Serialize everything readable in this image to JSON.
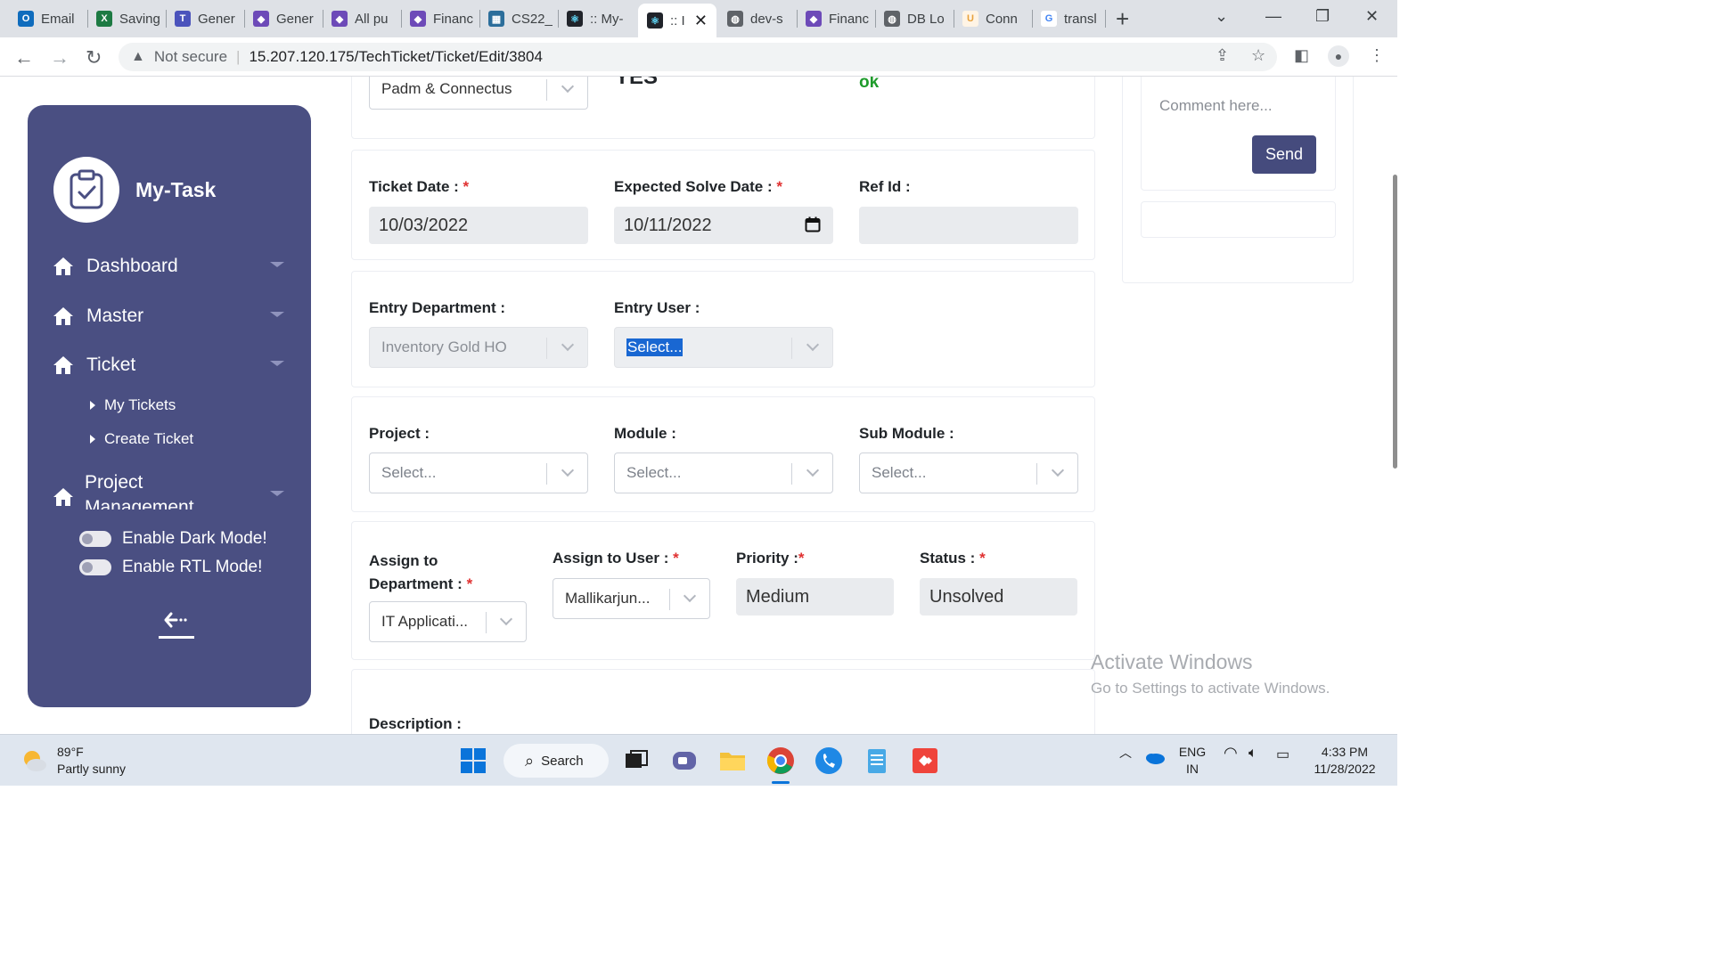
{
  "browser": {
    "tabs": [
      {
        "label": "Email",
        "color": "#0f6cbd",
        "glyph": "O"
      },
      {
        "label": "Saving",
        "color": "#1d7a43",
        "glyph": "X"
      },
      {
        "label": "Gener",
        "color": "#4b53bc",
        "glyph": "T"
      },
      {
        "label": "Gener",
        "color": "#6d4ab8",
        "glyph": "◆"
      },
      {
        "label": "All pu",
        "color": "#6d4ab8",
        "glyph": "◆"
      },
      {
        "label": "Financ",
        "color": "#6d4ab8",
        "glyph": "◆"
      },
      {
        "label": "CS22_",
        "color": "#2c6e9b",
        "glyph": "▦"
      },
      {
        "label": ":: My-",
        "color": "#20232a",
        "glyph": "⚛"
      },
      {
        "label": ":: I",
        "color": "#20232a",
        "glyph": "⚛"
      },
      {
        "label": "dev-s",
        "color": "#5f6368",
        "glyph": "◍"
      },
      {
        "label": "Financ",
        "color": "#6d4ab8",
        "glyph": "◆"
      },
      {
        "label": "DB Lo",
        "color": "#5f6368",
        "glyph": "◍"
      },
      {
        "label": "Conn",
        "color": "#e8a13a",
        "glyph": "U"
      },
      {
        "label": "transl",
        "color": "#ffffff",
        "glyph": "G"
      }
    ],
    "address": {
      "security": "Not secure",
      "url": "15.207.120.175/TechTicket/Ticket/Edit/3804"
    }
  },
  "sidebar": {
    "brand": "My-Task",
    "items": [
      {
        "label": "Dashboard"
      },
      {
        "label": "Master"
      },
      {
        "label": "Ticket"
      }
    ],
    "sub_items": [
      {
        "label": "My Tickets"
      },
      {
        "label": "Create Ticket"
      }
    ],
    "project_management": "Project Management",
    "toggles": [
      {
        "label": "Enable Dark Mode!"
      },
      {
        "label": "Enable RTL Mode!"
      }
    ]
  },
  "form": {
    "top": {
      "company_value": "Padm & Connectus",
      "yes_text": "YES",
      "ok_text": "ok"
    },
    "dates": {
      "ticket_date_label": "Ticket Date :",
      "ticket_date": "10/03/2022",
      "expected_label": "Expected Solve Date :",
      "expected_date": "10/11/2022",
      "refid_label": "Ref Id :",
      "refid": ""
    },
    "entry": {
      "dept_label": "Entry Department :",
      "dept_value": "Inventory Gold HO",
      "user_label": "Entry User :",
      "user_value": "Select..."
    },
    "project": {
      "project_label": "Project :",
      "project_value": "Select...",
      "module_label": "Module :",
      "module_value": "Select...",
      "submodule_label": "Sub Module :",
      "submodule_value": "Select..."
    },
    "assign": {
      "dept_label_1": "Assign to",
      "dept_label_2": "Department :",
      "dept_value": "IT Applicati...",
      "user_label": "Assign to User :",
      "user_value": "Mallikarjun...",
      "priority_label": "Priority :",
      "priority_value": "Medium",
      "status_label": "Status :",
      "status_value": "Unsolved"
    },
    "description_label": "Description :",
    "required_mark": "*"
  },
  "comments": {
    "placeholder": "Comment here...",
    "send_label": "Send"
  },
  "watermark": {
    "line1": "Activate Windows",
    "line2": "Go to Settings to activate Windows."
  },
  "taskbar": {
    "temperature": "89°F",
    "condition": "Partly sunny",
    "search_label": "Search",
    "lang_1": "ENG",
    "lang_2": "IN",
    "time": "4:33 PM",
    "date": "11/28/2022"
  }
}
